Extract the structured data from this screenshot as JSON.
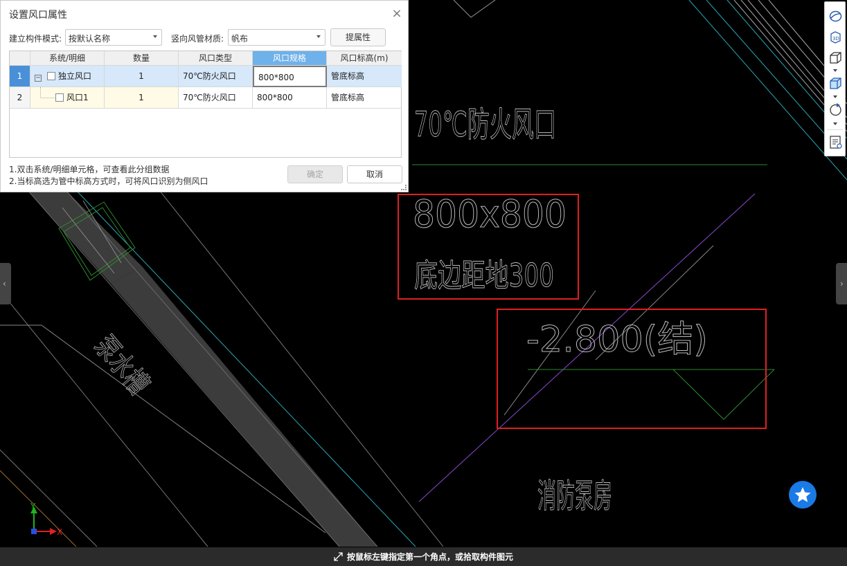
{
  "dialog": {
    "title": "设置风口属性",
    "mode_label": "建立构件模式:",
    "mode_value": "按默认名称",
    "material_label": "竖向风管材质:",
    "material_value": "帆布",
    "extract_button": "提属性",
    "columns": [
      "系统/明细",
      "数量",
      "风口类型",
      "风口规格",
      "风口标高(m)"
    ],
    "rows": [
      {
        "index": "1",
        "name": "独立风口",
        "qty": "1",
        "type": "70℃防火风口",
        "spec": "800*800",
        "elevation": "管底标高"
      },
      {
        "index": "2",
        "name": "风口1",
        "qty": "1",
        "type": "70℃防火风口",
        "spec": "800*800",
        "elevation": "管底标高"
      }
    ],
    "note1": "1.双击系统/明细单元格，可查看此分组数据",
    "note2": "2.当标高选为管中标高方式时，可将风口识别为侧风口",
    "ok_button": "确定",
    "cancel_button": "取消"
  },
  "cad": {
    "text_type": "70℃防火风口",
    "text_size": "800x800",
    "text_height": "底边距地300",
    "text_level": "-2.800(结)",
    "text_room": "消防泵房",
    "text_trench": "泵水槽",
    "axis_y": "Y",
    "axis_x": "X",
    "highlight_color": "#e02020"
  },
  "toolbar": {
    "icons": [
      "orbit-icon",
      "3d-view-icon",
      "cube-icon",
      "cube-shaded-icon",
      "rotate-icon",
      "property-list-icon"
    ]
  },
  "status": {
    "text": "按鼠标左键指定第一个角点，或拾取构件图元"
  }
}
